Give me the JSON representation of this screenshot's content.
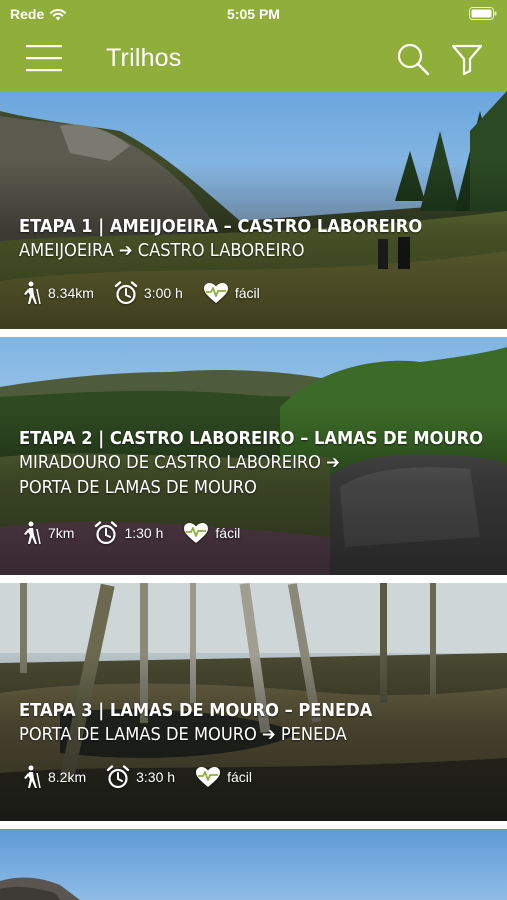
{
  "status_bar": {
    "carrier": "Rede",
    "time": "5:05 PM"
  },
  "app_bar": {
    "title": "Trilhos",
    "menu_icon": "hamburger-menu-icon",
    "search_icon": "search-icon",
    "filter_icon": "filter-icon"
  },
  "colors": {
    "brand_green": "#8fae3a"
  },
  "trails": [
    {
      "stage": "ETAPA 1 | AMEIJOEIRA – CASTRO LABOREIRO",
      "route_lines": [
        "AMEIJOEIRA ➔ CASTRO LABOREIRO"
      ],
      "distance": "8.34km",
      "duration": "3:00 h",
      "difficulty": "fácil"
    },
    {
      "stage": "ETAPA 2 | CASTRO LABOREIRO – LAMAS DE MOURO",
      "route_lines": [
        "MIRADOURO DE CASTRO LABOREIRO ➔",
        "PORTA DE LAMAS DE MOURO"
      ],
      "distance": "7km",
      "duration": "1:30 h",
      "difficulty": "fácil"
    },
    {
      "stage": "ETAPA 3 | LAMAS DE MOURO – PENEDA",
      "route_lines": [
        "PORTA DE LAMAS DE MOURO ➔ PENEDA"
      ],
      "distance": "8.2km",
      "duration": "3:30 h",
      "difficulty": "fácil"
    }
  ]
}
